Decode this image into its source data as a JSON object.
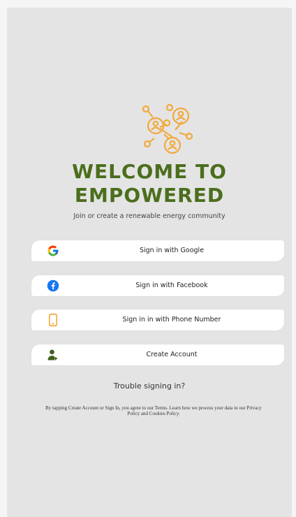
{
  "app": {
    "title_line1": "WELCOME TO",
    "title_line2": "EMPOWERED",
    "subtitle": "Join or create a renewable energy community"
  },
  "buttons": {
    "google": {
      "label": "Sign in with Google",
      "icon": "google-icon"
    },
    "facebook": {
      "label": "Sign in with Facebook",
      "icon": "facebook-icon"
    },
    "phone": {
      "label": "Sign in in with Phone Number",
      "icon": "phone-icon"
    },
    "create": {
      "label": "Create Account",
      "icon": "add-user-icon"
    }
  },
  "trouble_link": "Trouble signing in?",
  "terms": "By tapping Create Account or Sign In, you agree to our Terms. Learn how we process your data in our Privacy Policy and Cookies Policy.",
  "colors": {
    "brand_green": "#4b6e1c",
    "logo_orange": "#f2a93b",
    "facebook_blue": "#1877f2",
    "background": "#e4e4e4"
  }
}
